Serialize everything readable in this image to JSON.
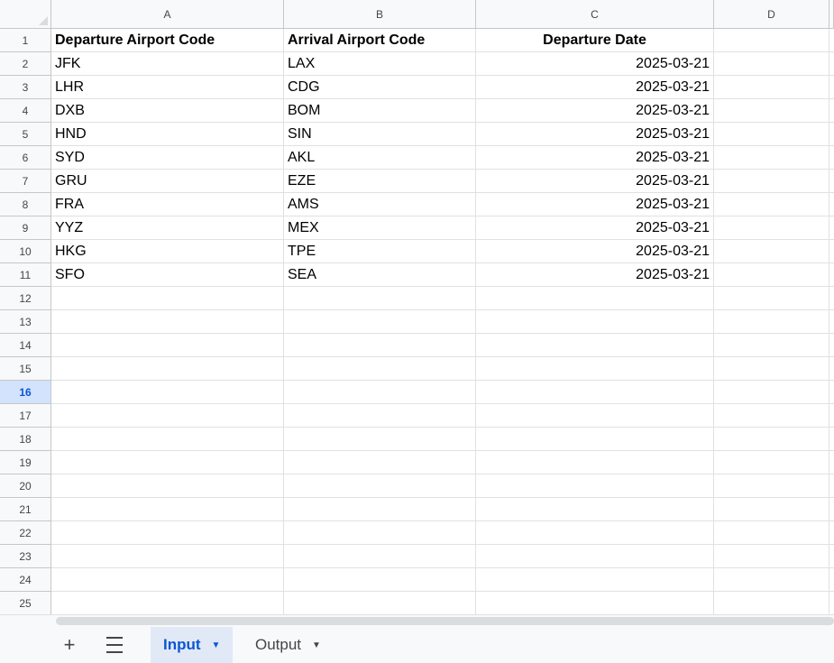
{
  "columns": [
    "A",
    "B",
    "C",
    "D"
  ],
  "header_row": {
    "number": "1",
    "cells": [
      "Departure Airport Code",
      "Arrival Airport Code",
      "Departure Date",
      ""
    ]
  },
  "rows": [
    {
      "number": "2",
      "departure": "JFK",
      "arrival": "LAX",
      "date": "2025-03-21"
    },
    {
      "number": "3",
      "departure": "LHR",
      "arrival": "CDG",
      "date": "2025-03-21"
    },
    {
      "number": "4",
      "departure": "DXB",
      "arrival": "BOM",
      "date": "2025-03-21"
    },
    {
      "number": "5",
      "departure": "HND",
      "arrival": "SIN",
      "date": "2025-03-21"
    },
    {
      "number": "6",
      "departure": "SYD",
      "arrival": "AKL",
      "date": "2025-03-21"
    },
    {
      "number": "7",
      "departure": "GRU",
      "arrival": "EZE",
      "date": "2025-03-21"
    },
    {
      "number": "8",
      "departure": "FRA",
      "arrival": "AMS",
      "date": "2025-03-21"
    },
    {
      "number": "9",
      "departure": "YYZ",
      "arrival": "MEX",
      "date": "2025-03-21"
    },
    {
      "number": "10",
      "departure": "HKG",
      "arrival": "TPE",
      "date": "2025-03-21"
    },
    {
      "number": "11",
      "departure": "SFO",
      "arrival": "SEA",
      "date": "2025-03-21"
    }
  ],
  "empty_rows": [
    "12",
    "13",
    "14",
    "15",
    "16",
    "17",
    "18",
    "19",
    "20",
    "21",
    "22",
    "23",
    "24",
    "25"
  ],
  "selected_row": "16",
  "sheet_tabs": [
    {
      "label": "Input",
      "active": true
    },
    {
      "label": "Output",
      "active": false
    }
  ],
  "toolbar": {
    "add_sheet_icon": "plus-icon",
    "all_sheets_icon": "hamburger-menu-icon"
  },
  "colors": {
    "accent": "#0b57d0",
    "selected_row_header": "#d3e3fd",
    "header_bg": "#f8f9fa",
    "active_tab_bg": "#e1e9f7"
  }
}
